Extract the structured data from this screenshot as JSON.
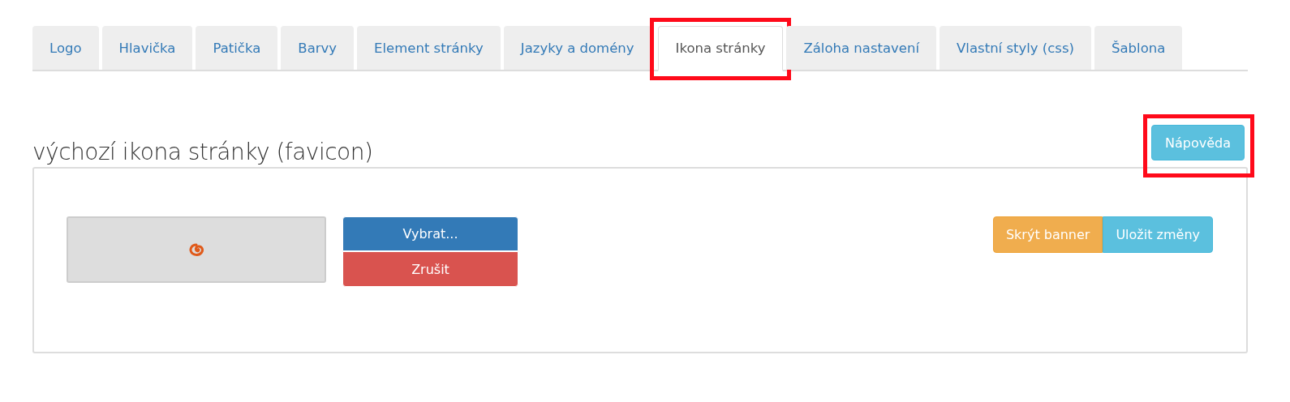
{
  "tabs": [
    {
      "label": "Logo",
      "selected": false,
      "highlighted": false
    },
    {
      "label": "Hlavička",
      "selected": false,
      "highlighted": false
    },
    {
      "label": "Patička",
      "selected": false,
      "highlighted": false
    },
    {
      "label": "Barvy",
      "selected": false,
      "highlighted": false
    },
    {
      "label": "Element stránky",
      "selected": false,
      "highlighted": false
    },
    {
      "label": "Jazyky a domény",
      "selected": false,
      "highlighted": false
    },
    {
      "label": "Ikona stránky",
      "selected": true,
      "highlighted": true
    },
    {
      "label": "Záloha nastavení",
      "selected": false,
      "highlighted": false
    },
    {
      "label": "Vlastní styly (css)",
      "selected": false,
      "highlighted": false
    },
    {
      "label": "Šablona",
      "selected": false,
      "highlighted": false
    }
  ],
  "heading": "výchozí ikona stránky (favicon)",
  "help_button": {
    "label": "Nápověda",
    "highlighted": true
  },
  "file_picker": {
    "select_label": "Vybrat...",
    "cancel_label": "Zrušit"
  },
  "actions": [
    {
      "label": "Skrýt banner",
      "kind": "warning"
    },
    {
      "label": "Uložit změny",
      "kind": "info"
    }
  ]
}
